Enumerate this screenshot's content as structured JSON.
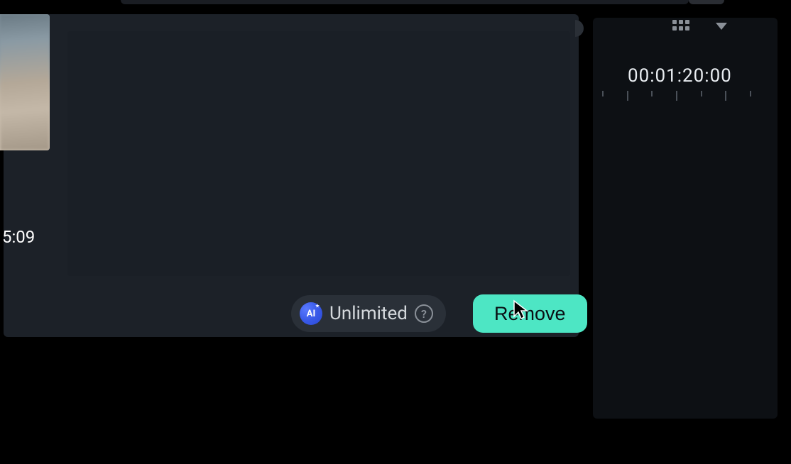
{
  "thumbnail": {
    "timestamp": "5:09"
  },
  "controls": {
    "ai_badge_text": "AI",
    "unlimited_label": "Unlimited",
    "help_symbol": "?",
    "remove_label": "Remove"
  },
  "right_panel": {
    "timecode": "00:01:20:00"
  }
}
